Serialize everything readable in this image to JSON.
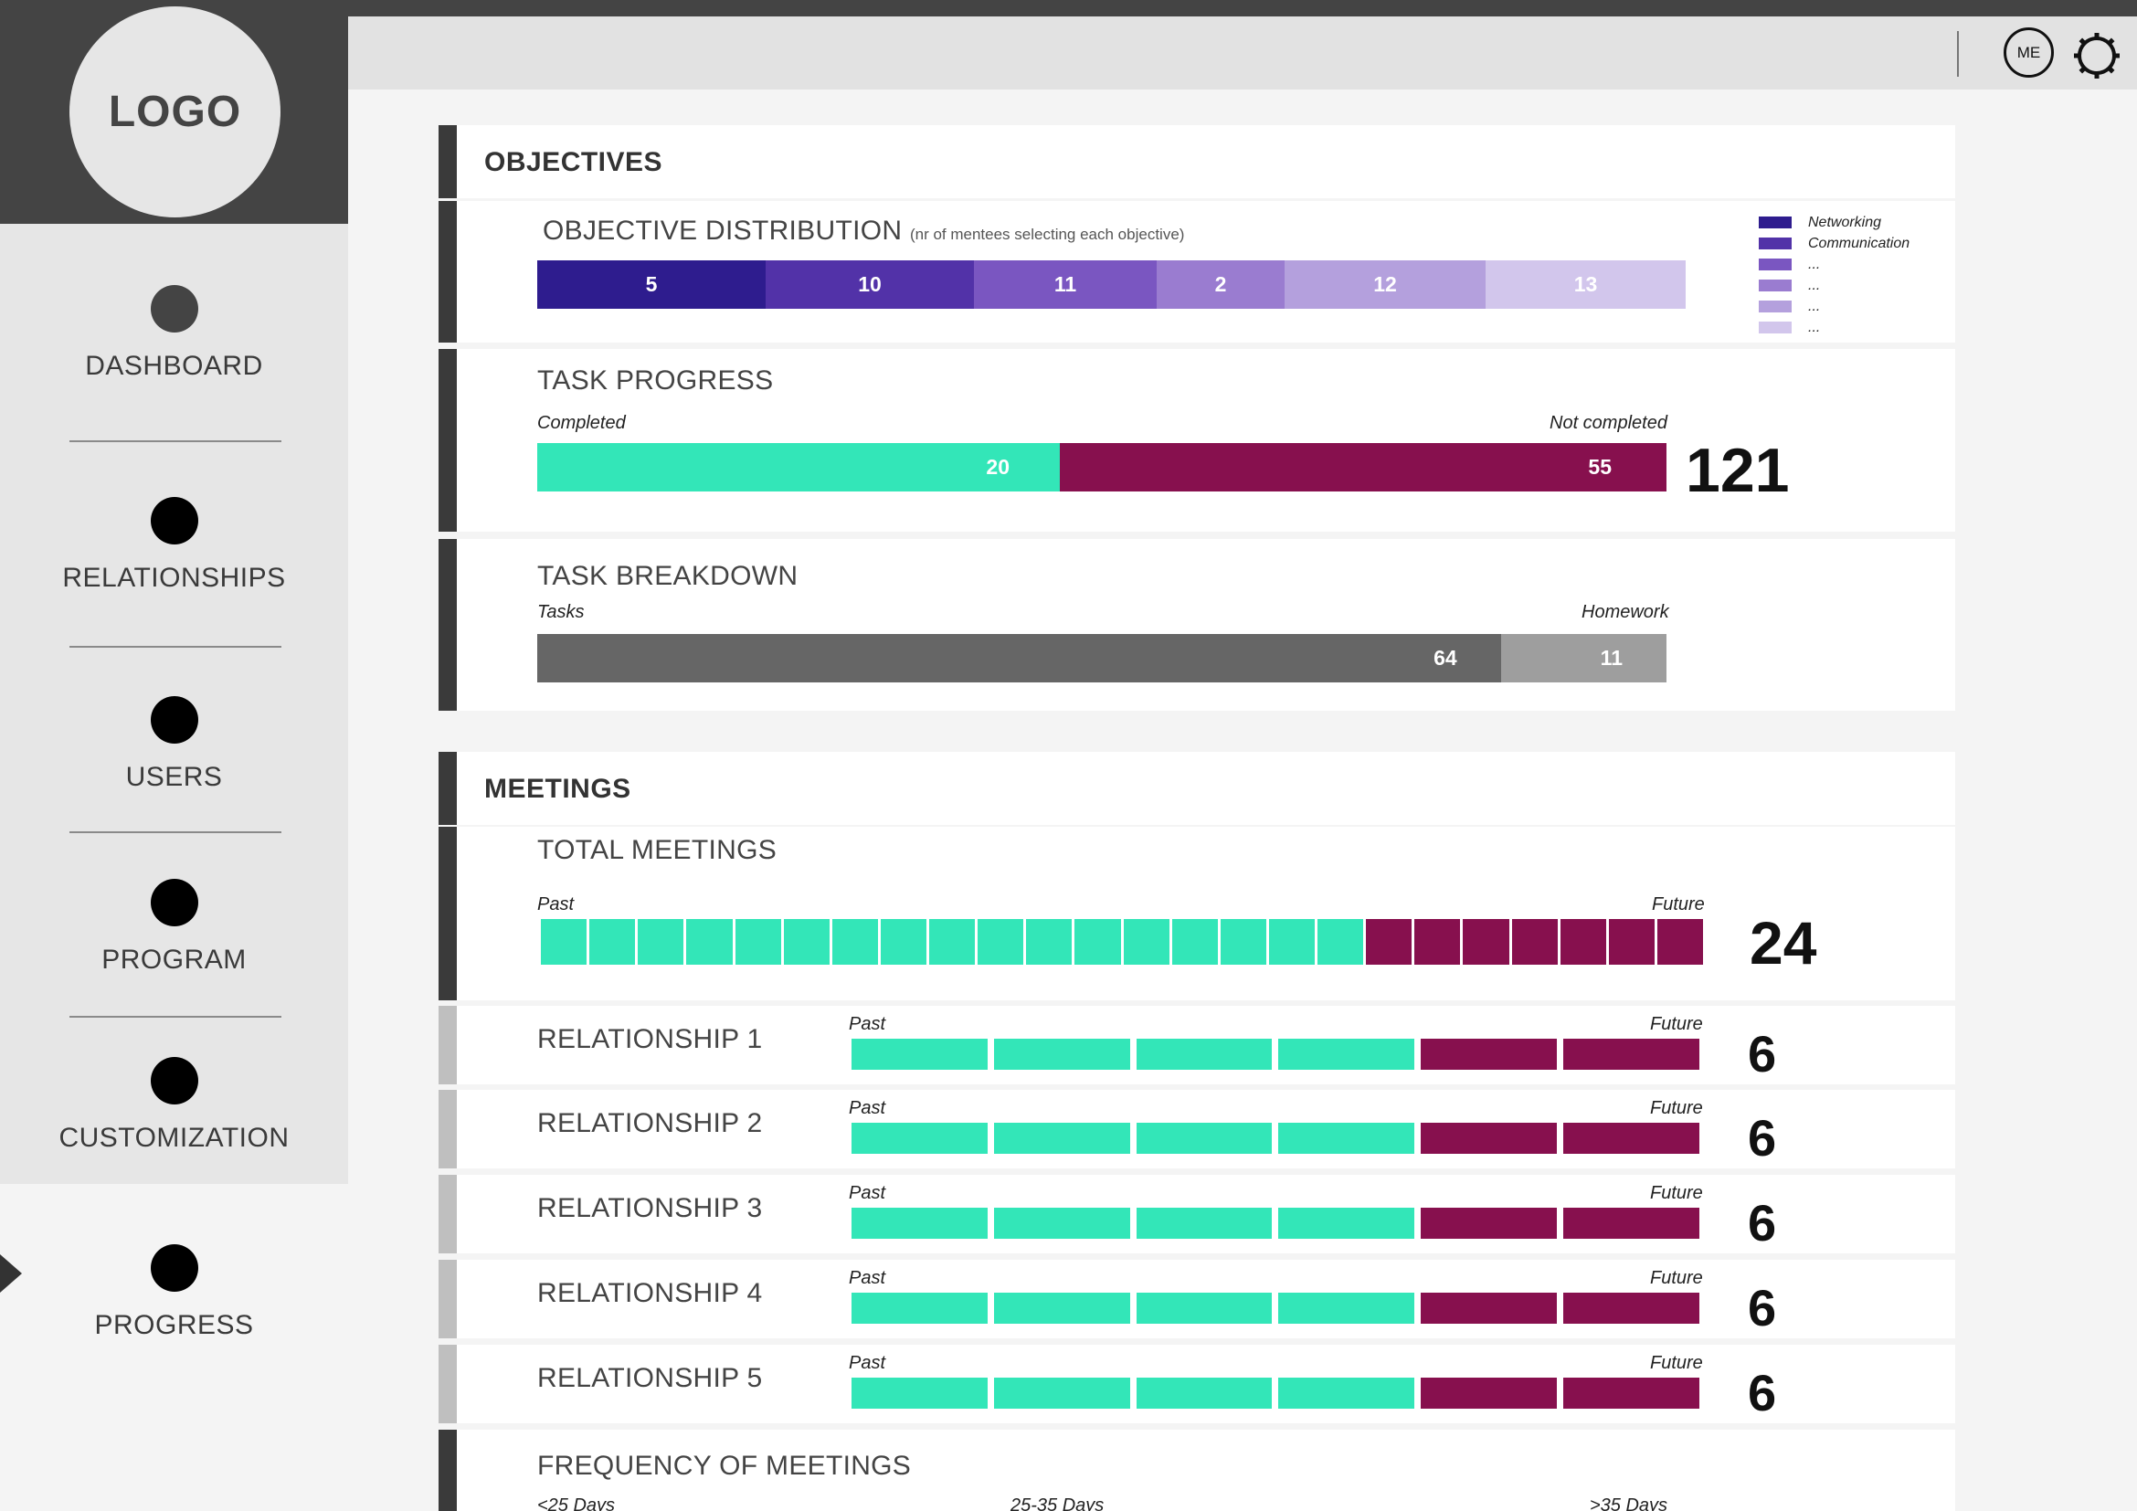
{
  "logo": "LOGO",
  "nav": [
    {
      "label": "DASHBOARD"
    },
    {
      "label": "RELATIONSHIPS"
    },
    {
      "label": "USERS"
    },
    {
      "label": "PROGRAM"
    },
    {
      "label": "CUSTOMIZATION"
    },
    {
      "label": "PROGRESS",
      "active": true
    }
  ],
  "topbar": {
    "user_initials": "ME"
  },
  "colors": {
    "teal": "#33e6b8",
    "maroon": "#87104e",
    "dark_gray": "#666666",
    "light_gray": "#9e9e9e",
    "purples": [
      "#2e1c8e",
      "#5232a8",
      "#7a56c1",
      "#9a7cd0",
      "#b4a0dd",
      "#d2c6ec"
    ]
  },
  "objectives": {
    "heading": "OBJECTIVES",
    "distribution": {
      "title": "OBJECTIVE DISTRIBUTION",
      "subtitle": "(nr of mentees selecting each objective)",
      "values": [
        5,
        10,
        11,
        2,
        12,
        13
      ],
      "value_labels": [
        "5",
        "10",
        "11",
        "2",
        "12",
        "13"
      ],
      "legend": [
        "Networking",
        "Communication",
        "...",
        "...",
        "...",
        "..."
      ]
    },
    "task_progress": {
      "title": "TASK PROGRESS",
      "left_label": "Completed",
      "right_label": "Not completed",
      "completed": 20,
      "completed_label": "20",
      "not_completed": 55,
      "not_completed_label": "55",
      "total": "121"
    },
    "task_breakdown": {
      "title": "TASK BREAKDOWN",
      "left_label": "Tasks",
      "right_label": "Homework",
      "tasks": 64,
      "tasks_label": "64",
      "homework": 11,
      "homework_label": "11"
    }
  },
  "meetings": {
    "heading": "MEETINGS",
    "total": {
      "title": "TOTAL MEETINGS",
      "past_label": "Past",
      "future_label": "Future",
      "past": 17,
      "future": 7,
      "count": "24"
    },
    "relationships": [
      {
        "name": "RELATIONSHIP 1",
        "past": 4,
        "future": 2,
        "count": "6",
        "past_label": "Past",
        "future_label": "Future"
      },
      {
        "name": "RELATIONSHIP 2",
        "past": 4,
        "future": 2,
        "count": "6",
        "past_label": "Past",
        "future_label": "Future"
      },
      {
        "name": "RELATIONSHIP 3",
        "past": 4,
        "future": 2,
        "count": "6",
        "past_label": "Past",
        "future_label": "Future"
      },
      {
        "name": "RELATIONSHIP 4",
        "past": 4,
        "future": 2,
        "count": "6",
        "past_label": "Past",
        "future_label": "Future"
      },
      {
        "name": "RELATIONSHIP 5",
        "past": 4,
        "future": 2,
        "count": "6",
        "past_label": "Past",
        "future_label": "Future"
      }
    ],
    "frequency": {
      "title": "FREQUENCY OF MEETINGS",
      "labels": [
        "<25 Days",
        "25-35 Days",
        ">35 Days"
      ]
    }
  }
}
